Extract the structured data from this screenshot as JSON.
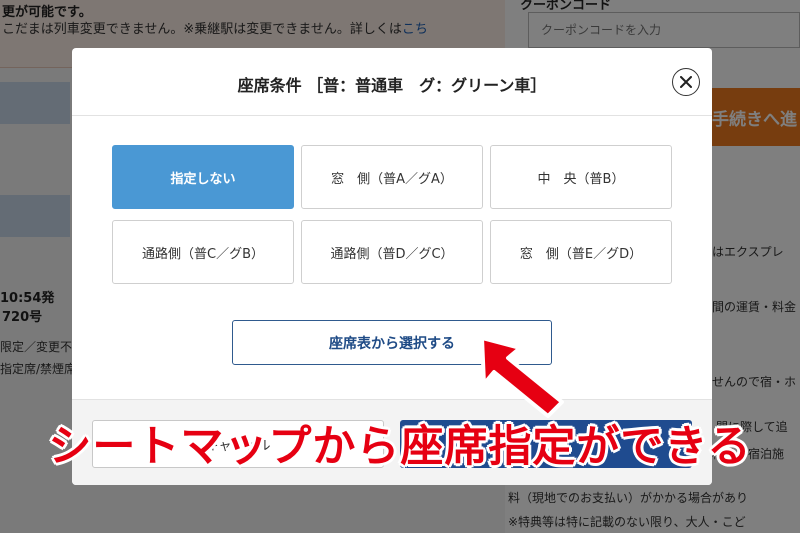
{
  "background": {
    "notice_line1": "更が可能です。",
    "notice_line2": "こだまは列車変更できません。※乗継駅は変更できません。詳しくは",
    "notice_link": "こち",
    "departure": "10:54発",
    "train_number": "720号",
    "restriction1": "限定／変更不",
    "restriction2": "指定席/禁煙席",
    "coupon_label": "クーポンコード",
    "coupon_placeholder": "クーポンコードを入力",
    "proceed_label": "手続きへ進",
    "right_text": [
      "はエクスプレ",
      "間の運賃・料金",
      "せんので宿・ホ",
      "間に際して追",
      "様は、宿泊施",
      "料（現地でのお支払い）がかかる場合があり",
      "※特典等は特に記載のない限り、大人・こど"
    ]
  },
  "modal": {
    "title": "座席条件 ［普：普通車　グ：グリーン車］",
    "close_icon": "close-icon",
    "options": [
      "指定しない",
      "窓　側（普A／グA）",
      "中　央（普B）",
      "通路側（普C／グB）",
      "通路側（普D／グC）",
      "窓　側（普E／グD）"
    ],
    "selected_option": "指定しない",
    "seat_map_button": "座席表から選択する",
    "cancel_label": "キャンセル",
    "confirm_label": ""
  },
  "annotation": {
    "caption": "シートマップから座席指定ができる",
    "arrow_icon": "red-arrow-icon",
    "color": "#e60012"
  },
  "colors": {
    "selected_option": "#4a98d4",
    "primary_button": "#1f4b8f",
    "proceed_button": "#ee7a1f"
  }
}
